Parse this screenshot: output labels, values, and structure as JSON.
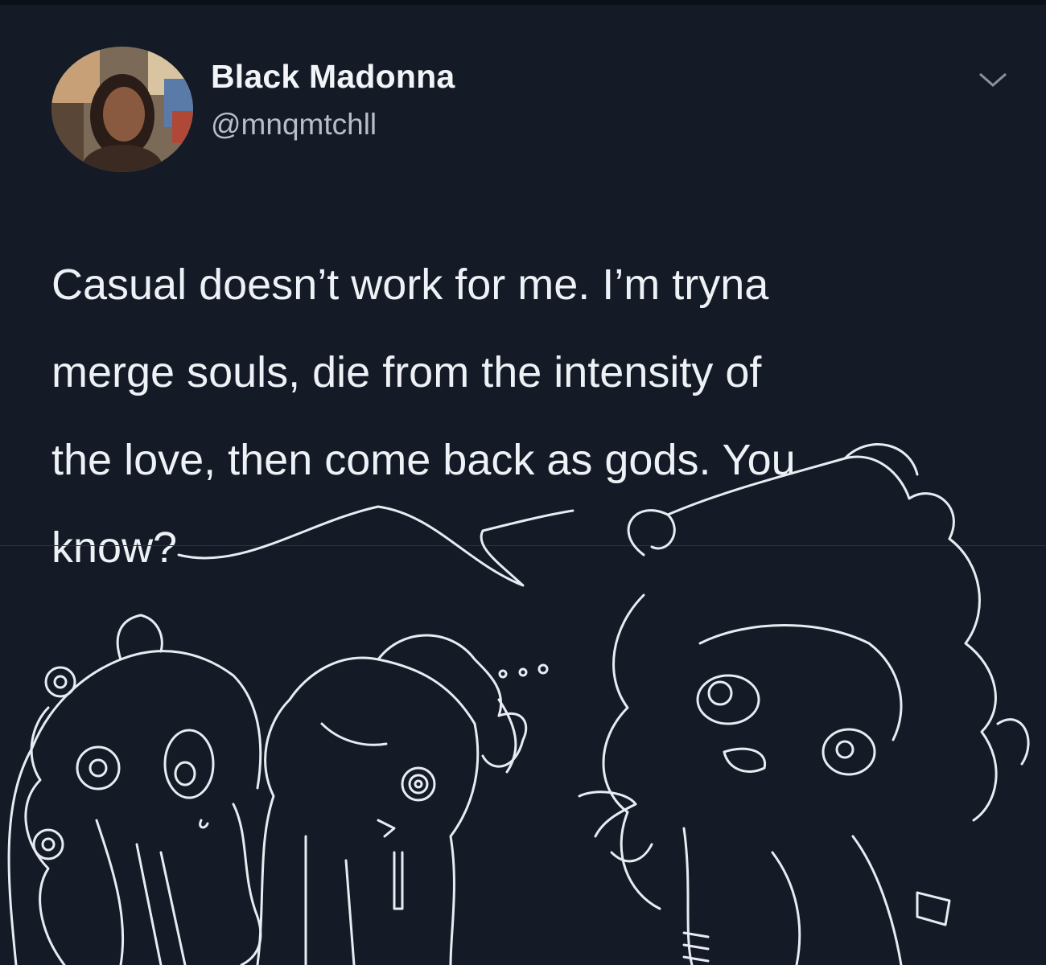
{
  "tweet": {
    "author_name": "Black Madonna",
    "author_handle": "@mnqmtchll",
    "text": "Casual doesn’t work for me. I’m tryna\nmerge souls, die from the intensity of\nthe love, then come back as gods. You\nknow?",
    "menu_icon": "chevron-down-icon"
  },
  "colors": {
    "background": "#141b26",
    "text": "#eef1f5",
    "handle": "#b8bec8",
    "sketch": "#e8ecf2"
  }
}
